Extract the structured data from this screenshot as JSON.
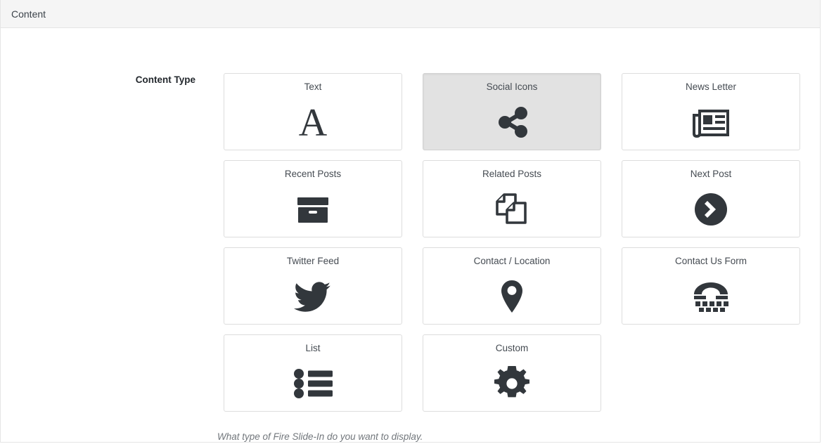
{
  "header": {
    "title": "Content"
  },
  "field": {
    "label": "Content Type",
    "help_text": "What type of Fire Slide-In do you want to display."
  },
  "theme": {
    "header_bg": "#f5f5f5",
    "border": "#dddddd",
    "selected_bg": "#e2e2e2",
    "icon_color": "#32373c",
    "label_color": "#454b52",
    "help_color": "#72777c"
  },
  "content_types": {
    "selected": "Social Icons",
    "rows": [
      [
        {
          "label": "Text",
          "icon": "letter-a-icon",
          "selected": false
        },
        {
          "label": "Social Icons",
          "icon": "share-nodes-icon",
          "selected": true
        },
        {
          "label": "News Letter",
          "icon": "newspaper-icon",
          "selected": false
        }
      ],
      [
        {
          "label": "Recent Posts",
          "icon": "archive-box-icon",
          "selected": false
        },
        {
          "label": "Related Posts",
          "icon": "copy-pages-icon",
          "selected": false
        },
        {
          "label": "Next Post",
          "icon": "chevron-right-circle-icon",
          "selected": false
        }
      ],
      [
        {
          "label": "Twitter Feed",
          "icon": "twitter-bird-icon",
          "selected": false
        },
        {
          "label": "Contact / Location",
          "icon": "map-pin-icon",
          "selected": false
        },
        {
          "label": "Contact Us Form",
          "icon": "telephone-keypad-icon",
          "selected": false
        }
      ],
      [
        {
          "label": "List",
          "icon": "bulleted-list-icon",
          "selected": false
        },
        {
          "label": "Custom",
          "icon": "gear-icon",
          "selected": false
        }
      ]
    ]
  }
}
